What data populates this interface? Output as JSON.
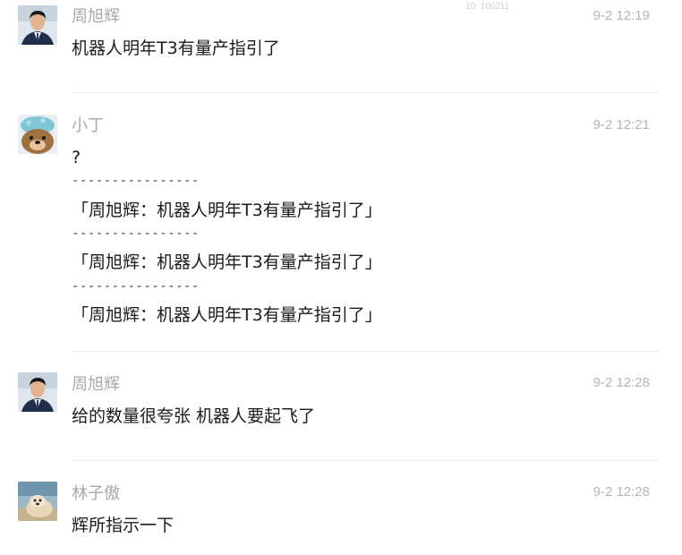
{
  "watermark": "10: 100211",
  "messages": [
    {
      "sender": "周旭辉",
      "time": "9-2 12:19",
      "avatar_icon": "man-in-suit-avatar",
      "lines": [
        "机器人明年T3有量产指引了"
      ]
    },
    {
      "sender": "小丁",
      "time": "9-2 12:21",
      "avatar_icon": "cartoon-bear-avatar",
      "lines": [
        "?"
      ],
      "quotes": [
        {
          "separator": "----------------",
          "text": "「周旭辉：机器人明年T3有量产指引了」"
        },
        {
          "separator": "----------------",
          "text": "「周旭辉：机器人明年T3有量产指引了」"
        },
        {
          "separator": "----------------",
          "text": "「周旭辉：机器人明年T3有量产指引了」"
        }
      ]
    },
    {
      "sender": "周旭辉",
      "time": "9-2 12:28",
      "avatar_icon": "man-in-suit-avatar",
      "lines": [
        "给的数量很夸张 机器人要起飞了"
      ]
    },
    {
      "sender": "林子傲",
      "time": "9-2 12:28",
      "avatar_icon": "dog-photo-avatar",
      "lines": [
        "辉所指示一下"
      ]
    }
  ]
}
